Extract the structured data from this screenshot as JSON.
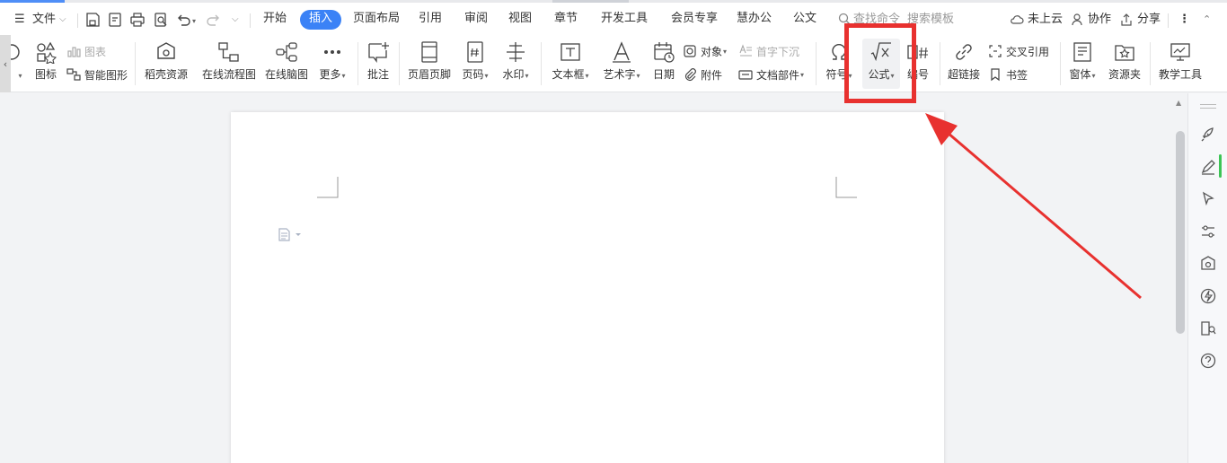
{
  "menu": {
    "file_label": "文件",
    "tabs": [
      {
        "label": "开始"
      },
      {
        "label": "插入"
      },
      {
        "label": "页面布局"
      },
      {
        "label": "引用"
      },
      {
        "label": "审阅"
      },
      {
        "label": "视图"
      },
      {
        "label": "章节"
      },
      {
        "label": "开发工具"
      },
      {
        "label": "会员专享"
      },
      {
        "label": "慧办公"
      },
      {
        "label": "公文"
      }
    ],
    "active_tab": "插入",
    "search_commands": "查找命令",
    "search_templates": "搜索模板",
    "cloud_status": "未上云",
    "collaborate": "协作",
    "share": "分享"
  },
  "ribbon": {
    "icons_label": "图标",
    "chart_label": "图表",
    "smartart_label": "智能图形",
    "daoke_label": "稻壳资源",
    "flowchart_label": "在线流程图",
    "mindmap_label": "在线脑图",
    "more_label": "更多",
    "comment_label": "批注",
    "header_footer_label": "页眉页脚",
    "page_number_label": "页码",
    "watermark_label": "水印",
    "textbox_label": "文本框",
    "wordart_label": "艺术字",
    "date_label": "日期",
    "object_label": "对象",
    "attachment_label": "附件",
    "dropcap_label": "首字下沉",
    "docpart_label": "文档部件",
    "symbol_label": "符号",
    "equation_label": "公式",
    "numbering_label": "编号",
    "hyperlink_label": "超链接",
    "crossref_label": "交叉引用",
    "bookmark_label": "书签",
    "form_label": "窗体",
    "resource_folder_label": "资源夹",
    "teaching_tools_label": "教学工具"
  },
  "colors": {
    "accent": "#3b82f6",
    "annotation": "#e8312f",
    "scroll_green": "#3cc455"
  }
}
